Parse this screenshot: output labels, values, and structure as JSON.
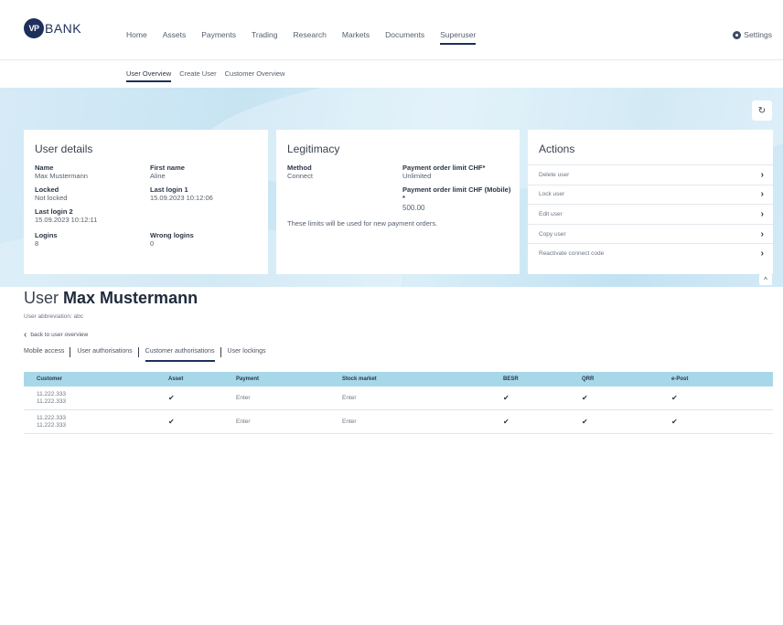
{
  "brand": {
    "badge": "VP",
    "name": "BANK"
  },
  "nav": {
    "items": [
      "Home",
      "Assets",
      "Payments",
      "Trading",
      "Research",
      "Markets",
      "Documents",
      "Superuser"
    ],
    "active_index": 7,
    "settings": "Settings"
  },
  "subnav": {
    "items": [
      "User Overview",
      "Create User",
      "Customer Overview"
    ],
    "active_index": 0
  },
  "refresh_icon": "↻",
  "collapse_icon": "^",
  "user_details": {
    "title": "User details",
    "name_label": "Name",
    "name_value": "Max Mustermann",
    "first_name_label": "First name",
    "first_name_value": "Aline",
    "locked_label": "Locked",
    "locked_value": "Not locked",
    "last_login1_label": "Last login 1",
    "last_login1_value": "15.09.2023 10:12:06",
    "last_login2_label": "Last login 2",
    "last_login2_value": "15.09.2023 10:12:11",
    "logins_label": "Logins",
    "logins_value": "8",
    "wrong_logins_label": "Wrong logins",
    "wrong_logins_value": "0"
  },
  "legitimacy": {
    "title": "Legitimacy",
    "method_label": "Method",
    "method_value": "Connect",
    "limit_label": "Payment order limit CHF*",
    "limit_value": "Unlimited",
    "mobile_limit_label": "Payment order limit CHF (Mobile)",
    "mobile_limit_star": "*",
    "mobile_limit_value": "500.00",
    "note": "These limits will be used for new payment orders."
  },
  "actions": {
    "title": "Actions",
    "items": [
      "Delete user",
      "Lock user",
      "Edit user",
      "Copy user",
      "Reactivate connect code"
    ]
  },
  "user_header": {
    "prefix": "User",
    "name": "Max Mustermann",
    "abbreviation": "User abbreviation: abc",
    "back": "back to user overview"
  },
  "tabs": {
    "items": [
      "Mobile access",
      "User authorisations",
      "Customer authorisations",
      "User lockings"
    ],
    "active_index": 2
  },
  "table": {
    "columns": [
      "Customer",
      "Asset",
      "Payment",
      "Stock market",
      "BESR",
      "QRR",
      "e-Post"
    ],
    "rows": [
      {
        "customer_line1": "11.222.333",
        "customer_line2": "11.222.333",
        "asset": "✔",
        "payment": "Enter",
        "stock": "Enter",
        "besr": "✔",
        "qrr": "✔",
        "epost": "✔"
      },
      {
        "customer_line1": "11.222.333",
        "customer_line2": "11.222.333",
        "asset": "✔",
        "payment": "Enter",
        "stock": "Enter",
        "besr": "✔",
        "qrr": "✔",
        "epost": "✔"
      }
    ]
  }
}
